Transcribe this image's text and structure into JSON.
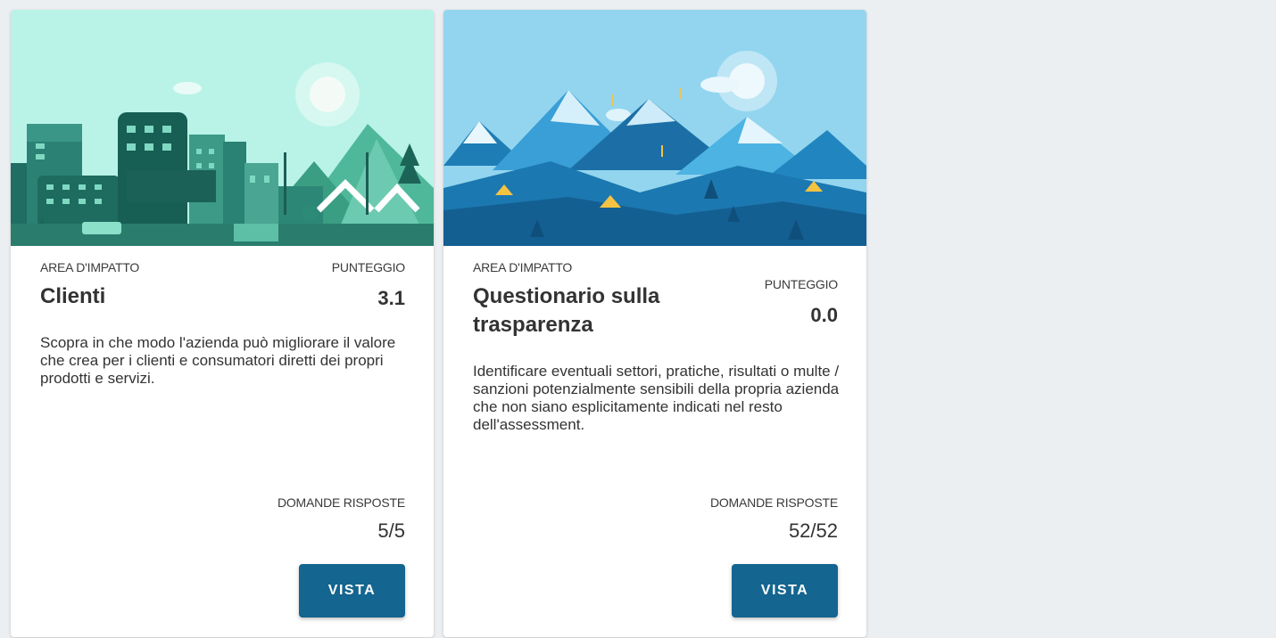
{
  "cards": [
    {
      "area_label": "AREA D'IMPATTO",
      "title": "Clienti",
      "score_label": "PUNTEGGIO",
      "score": "3.1",
      "description": "Scopra in che modo l'azienda può migliorare il valore che crea per i clienti e consumatori diretti dei propri prodotti e servizi.",
      "answers_label": "DOMANDE RISPOSTE",
      "answers": "5/5",
      "button_label": "VISTA",
      "banner": "city-illustration"
    },
    {
      "area_label": "AREA D'IMPATTO",
      "title": "Questionario sulla trasparenza",
      "score_label": "PUNTEGGIO",
      "score": "0.0",
      "description": "Identificare eventuali settori, pratiche, risultati o multe / sanzioni potenzialmente sensibili della propria azienda che non siano esplicitamente indicati nel resto dell'assessment.",
      "answers_label": "DOMANDE RISPOSTE",
      "answers": "52/52",
      "button_label": "VISTA",
      "banner": "mountain-illustration"
    }
  ],
  "colors": {
    "button": "#146590",
    "page_background": "#eceff1",
    "city_sky": "#b9f3e8",
    "mountain_sky": "#93d5ef"
  }
}
